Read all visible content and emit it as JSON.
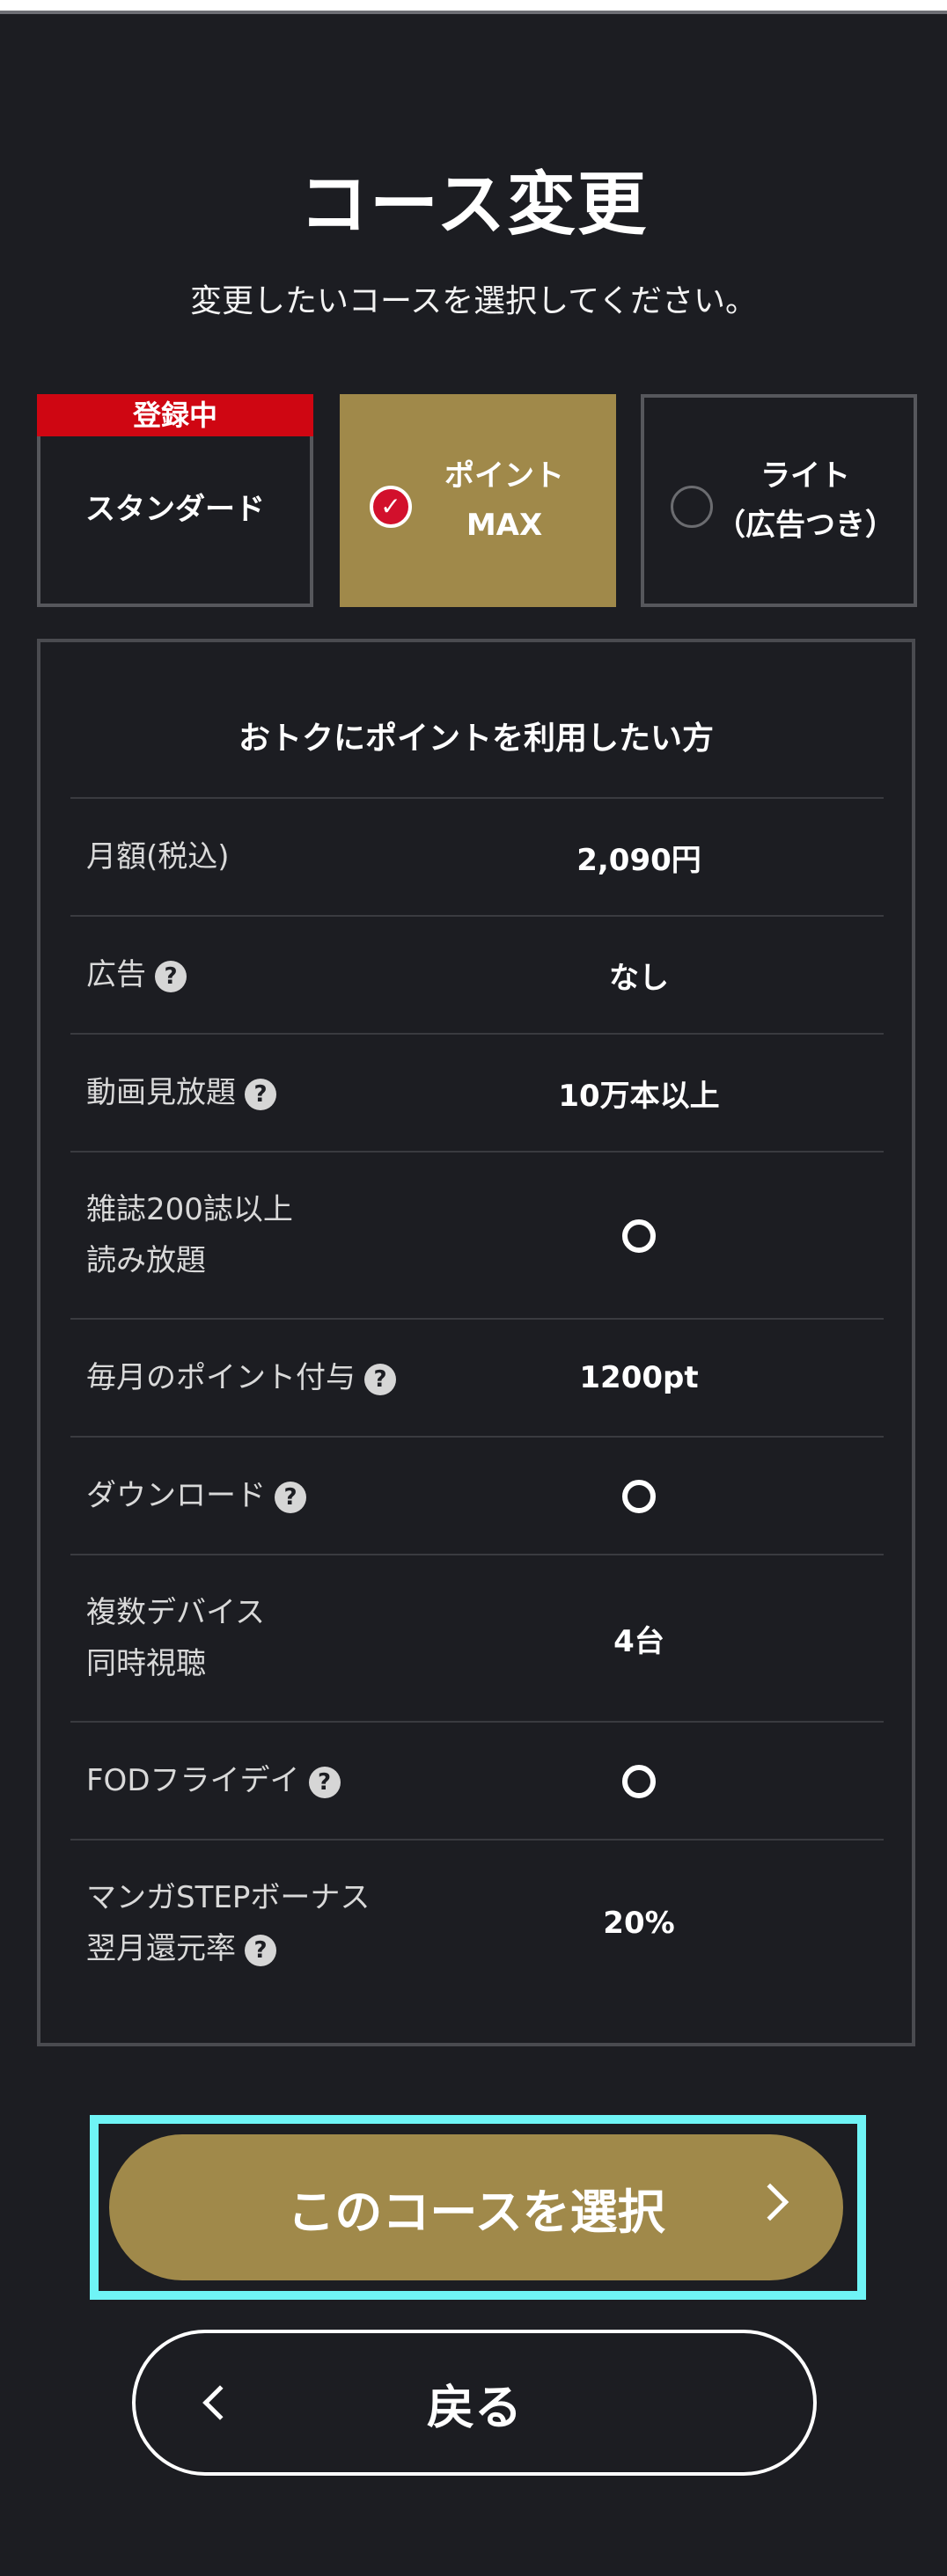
{
  "header": {
    "title": "コース変更",
    "subtitle": "変更したいコースを選択してください。"
  },
  "courses": [
    {
      "badge": "登録中",
      "label": "スタンダード",
      "selected": false
    },
    {
      "label_line1": "ポイント",
      "label_line2": "MAX",
      "selected": true
    },
    {
      "label_line1": "ライト",
      "label_line2": "（広告つき）",
      "selected": false
    }
  ],
  "details": {
    "heading": "おトクにポイントを利用したい方",
    "rows": [
      {
        "feature": "月額(税込)",
        "value": "2,090円",
        "help": false
      },
      {
        "feature": "広告",
        "value": "なし",
        "help": true
      },
      {
        "feature": "動画見放題",
        "value": "10万本以上",
        "help": true
      },
      {
        "feature_line1": "雑誌200誌以上",
        "feature_line2": "読み放題",
        "value": "○",
        "help": false
      },
      {
        "feature": "毎月のポイント付与",
        "value": "1200pt",
        "help": true
      },
      {
        "feature": "ダウンロード",
        "value": "○",
        "help": true
      },
      {
        "feature_line1": "複数デバイス",
        "feature_line2": "同時視聴",
        "value": "4台",
        "help": false
      },
      {
        "feature": "FODフライデイ",
        "value": "○",
        "help": true
      },
      {
        "feature_line1": "マンガSTEPボーナス",
        "feature_line2": "翌月還元率",
        "value": "20%",
        "help": true
      }
    ]
  },
  "actions": {
    "select_label": "このコースを選択",
    "back_label": "戻る"
  },
  "colors": {
    "background": "#1c1d22",
    "accent_gold": "#a0894a",
    "badge_red": "#cf0612",
    "highlight_cyan": "#6ff4f6"
  }
}
